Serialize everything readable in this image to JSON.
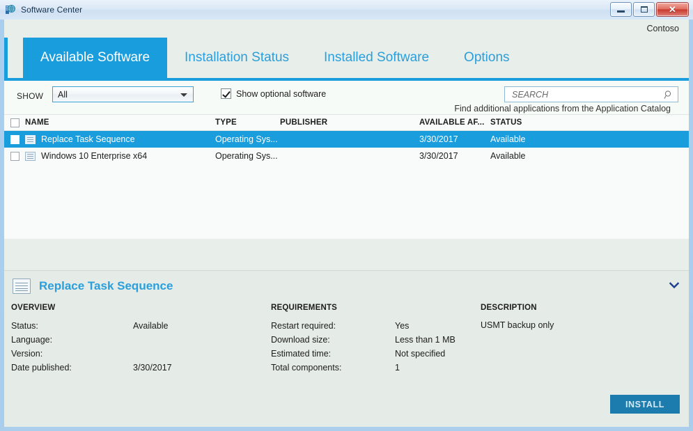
{
  "window": {
    "title": "Software Center",
    "icon": "software-center-icon",
    "controls": {
      "minimize": "minimize-icon",
      "maximize": "maximize-icon",
      "close": "✕"
    }
  },
  "organization": "Contoso",
  "tabs": [
    {
      "label": "Available Software",
      "active": true
    },
    {
      "label": "Installation Status",
      "active": false
    },
    {
      "label": "Installed Software",
      "active": false
    },
    {
      "label": "Options",
      "active": false
    }
  ],
  "toolbar": {
    "show_label": "SHOW",
    "show_value": "All",
    "show_options": [
      "All"
    ],
    "optional_checkbox_label": "Show optional software",
    "optional_checkbox_checked": true,
    "search_placeholder": "SEARCH",
    "search_value": "",
    "search_icon": "search-icon",
    "catalog_link": "Find additional applications from the Application Catalog"
  },
  "list": {
    "columns": [
      "NAME",
      "TYPE",
      "PUBLISHER",
      "AVAILABLE AF...",
      "STATUS"
    ],
    "rows": [
      {
        "name": "Replace Task Sequence",
        "type": "Operating Sys...",
        "publisher": "",
        "available_after": "3/30/2017",
        "status": "Available",
        "selected": true,
        "checked": false,
        "icon": "task-sequence-icon"
      },
      {
        "name": "Windows 10 Enterprise x64",
        "type": "Operating Sys...",
        "publisher": "",
        "available_after": "3/30/2017",
        "status": "Available",
        "selected": false,
        "checked": false,
        "icon": "task-sequence-icon"
      }
    ]
  },
  "detail": {
    "icon": "task-sequence-icon",
    "title": "Replace Task Sequence",
    "collapse_icon": "chevron-down-icon",
    "overview": {
      "heading": "OVERVIEW",
      "items": [
        {
          "key": "Status:",
          "value": "Available"
        },
        {
          "key": "Language:",
          "value": ""
        },
        {
          "key": "Version:",
          "value": ""
        },
        {
          "key": "Date published:",
          "value": "3/30/2017"
        }
      ]
    },
    "requirements": {
      "heading": "REQUIREMENTS",
      "items": [
        {
          "key": "Restart required:",
          "value": "Yes"
        },
        {
          "key": "Download size:",
          "value": "Less than 1 MB"
        },
        {
          "key": "Estimated time:",
          "value": "Not specified"
        },
        {
          "key": "Total components:",
          "value": "1"
        }
      ]
    },
    "description": {
      "heading": "DESCRIPTION",
      "text": "USMT backup only"
    },
    "install_button": "INSTALL"
  },
  "colors": {
    "accent": "#1a9ddd",
    "install_button": "#1b7cad",
    "tab_text": "#2a9fdc",
    "list_bg": "#f8fbf9",
    "detail_bg": "#e5ebe6"
  }
}
